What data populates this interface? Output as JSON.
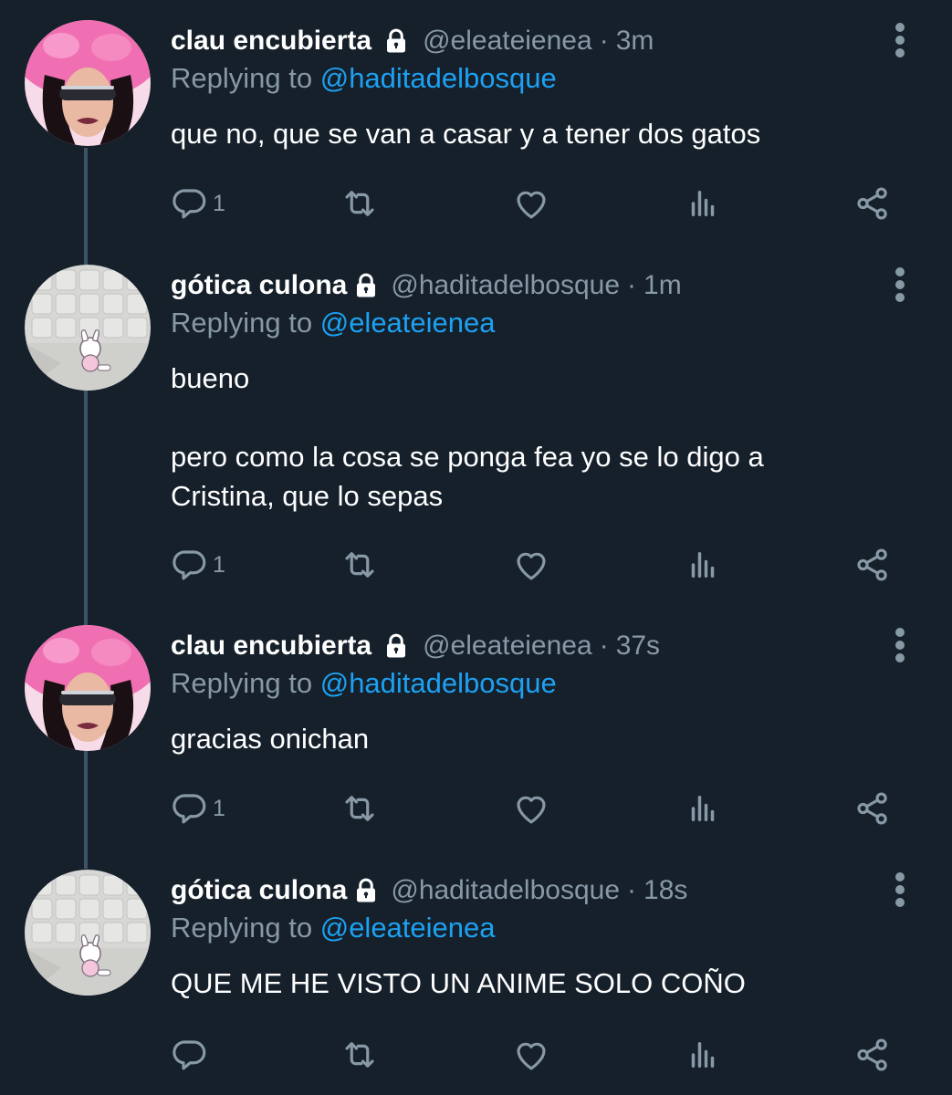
{
  "tweets": [
    {
      "name": "clau encubierta",
      "handle": "@eleateienea",
      "dot": "·",
      "time": "3m",
      "replying_prefix": "Replying to ",
      "replying_to": "@haditadelbosque",
      "text": "que no, que se van a casar y a tener dos gatos",
      "reply_count": "1",
      "avatar": "bratz-doll-pink-fur-avatar"
    },
    {
      "name": "gótica culona",
      "handle": "@haditadelbosque",
      "dot": "·",
      "time": "1m",
      "replying_prefix": "Replying to ",
      "replying_to": "@eleateienea",
      "text": "bueno\n\npero como la cosa se ponga fea yo se lo digo a\nCristina, que lo sepas",
      "reply_count": "1",
      "avatar": "padded-room-bunny-avatar"
    },
    {
      "name": "clau encubierta",
      "handle": "@eleateienea",
      "dot": "·",
      "time": "37s",
      "replying_prefix": "Replying to ",
      "replying_to": "@haditadelbosque",
      "text": "gracias onichan",
      "reply_count": "1",
      "avatar": "bratz-doll-pink-fur-avatar"
    },
    {
      "name": "gótica culona",
      "handle": "@haditadelbosque",
      "dot": "·",
      "time": "18s",
      "replying_prefix": "Replying to ",
      "replying_to": "@eleateienea",
      "text": "QUE ME HE VISTO UN ANIME SOLO COÑO",
      "reply_count": "",
      "avatar": "padded-room-bunny-avatar"
    }
  ],
  "icons": {
    "reply": "reply-icon",
    "retweet": "retweet-icon",
    "like": "heart-icon",
    "analytics": "analytics-icon",
    "share": "share-icon",
    "protected": "lock-icon",
    "more": "more-options-icon"
  },
  "colors": {
    "background": "#15202b",
    "primary_text": "#ffffff",
    "secondary_text": "#8899a6",
    "mention": "#1da1f2",
    "thread_line": "#3d5466",
    "avatar_fur": "#f06fb2"
  }
}
